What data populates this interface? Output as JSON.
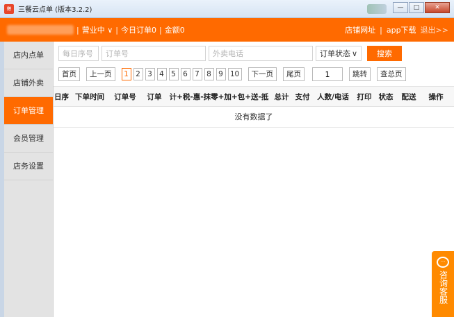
{
  "window": {
    "title": "三餐云点单 (版本3.2.2)",
    "icon": "app-logo-icon",
    "controls": [
      "minimize-icon",
      "maximize-icon",
      "close-icon"
    ]
  },
  "topbar": {
    "status": "营业中",
    "today_orders": "今日订单0",
    "amount": "金额0",
    "shop_url": "店铺网址",
    "app_download": "app下载",
    "logout": "退出>>",
    "accent": "#ff6a00"
  },
  "sidebar": {
    "items": [
      {
        "label": "店内点单",
        "active": false
      },
      {
        "label": "店铺外卖",
        "active": false
      },
      {
        "label": "订单管理",
        "active": true
      },
      {
        "label": "会员管理",
        "active": false
      },
      {
        "label": "店务设置",
        "active": false
      }
    ]
  },
  "search": {
    "day_placeholder": "每日序号",
    "order_placeholder": "订单号",
    "phone_placeholder": "外卖电话",
    "status_select": "订单状态",
    "search_label": "搜索"
  },
  "pager": {
    "first": "首页",
    "prev": "上一页",
    "pages": [
      "1",
      "2",
      "3",
      "4",
      "5",
      "6",
      "7",
      "8",
      "9",
      "10"
    ],
    "current": "1",
    "next": "下一页",
    "last": "尾页",
    "page_value": "1",
    "jump": "跳转",
    "total": "查总页"
  },
  "table": {
    "headers": [
      "日序",
      "下单时间",
      "订单号",
      "订单",
      "计+税-惠-抹零+加+包+送-抵",
      "总计",
      "支付",
      "人数/电话",
      "打印",
      "状态",
      "配送",
      "操作"
    ],
    "empty_text": "没有数据了"
  },
  "consult": {
    "icon": "chat-bubble-icon",
    "label": "咨询客服"
  }
}
